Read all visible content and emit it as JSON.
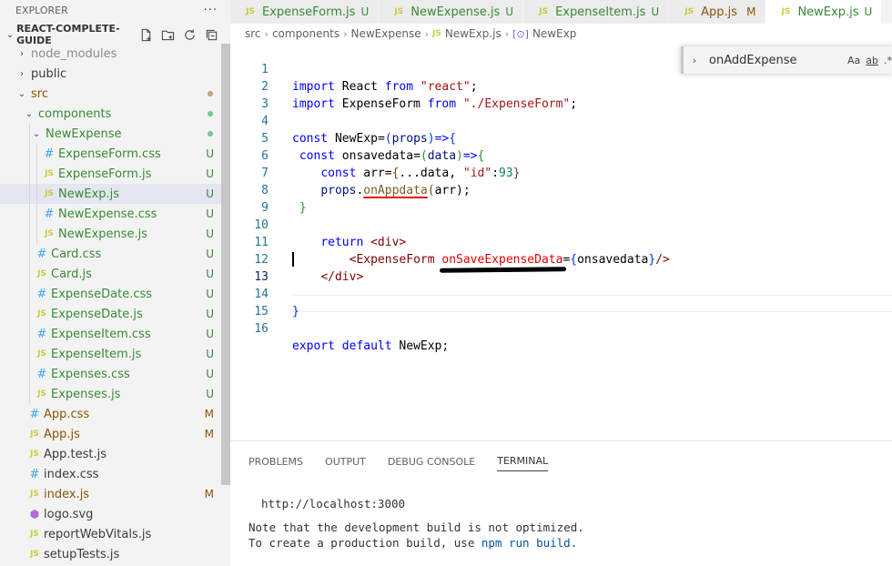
{
  "sidebar": {
    "header": "EXPLORER",
    "more": "···",
    "project": "REACT-COMPLETE-GUIDE",
    "tree": [
      {
        "name": "node_modules",
        "type": "folder",
        "depth": 0,
        "open": false,
        "style": "dim"
      },
      {
        "name": "public",
        "type": "folder",
        "depth": 0,
        "open": false,
        "style": "plain"
      },
      {
        "name": "src",
        "type": "folder",
        "depth": 0,
        "open": true,
        "style": "modified",
        "dot": "tan"
      },
      {
        "name": "components",
        "type": "folder",
        "depth": 1,
        "open": true,
        "style": "untracked",
        "dot": "green"
      },
      {
        "name": "NewExpense",
        "type": "folder",
        "depth": 2,
        "open": true,
        "style": "untracked",
        "dot": "green"
      },
      {
        "name": "ExpenseForm.css",
        "type": "css",
        "depth": 3,
        "style": "untracked",
        "badge": "U"
      },
      {
        "name": "ExpenseForm.js",
        "type": "js",
        "depth": 3,
        "style": "untracked",
        "badge": "U"
      },
      {
        "name": "NewExp.js",
        "type": "js",
        "depth": 3,
        "style": "untracked",
        "badge": "U",
        "selected": true
      },
      {
        "name": "NewExpense.css",
        "type": "css",
        "depth": 3,
        "style": "untracked",
        "badge": "U"
      },
      {
        "name": "NewExpense.js",
        "type": "js",
        "depth": 3,
        "style": "untracked",
        "badge": "U"
      },
      {
        "name": "Card.css",
        "type": "css",
        "depth": 2,
        "style": "untracked",
        "badge": "U"
      },
      {
        "name": "Card.js",
        "type": "js",
        "depth": 2,
        "style": "untracked",
        "badge": "U"
      },
      {
        "name": "ExpenseDate.css",
        "type": "css",
        "depth": 2,
        "style": "untracked",
        "badge": "U"
      },
      {
        "name": "ExpenseDate.js",
        "type": "js",
        "depth": 2,
        "style": "untracked",
        "badge": "U"
      },
      {
        "name": "ExpenseItem.css",
        "type": "css",
        "depth": 2,
        "style": "untracked",
        "badge": "U"
      },
      {
        "name": "ExpenseItem.js",
        "type": "js",
        "depth": 2,
        "style": "untracked",
        "badge": "U"
      },
      {
        "name": "Expenses.css",
        "type": "css",
        "depth": 2,
        "style": "untracked",
        "badge": "U"
      },
      {
        "name": "Expenses.js",
        "type": "js",
        "depth": 2,
        "style": "untracked",
        "badge": "U"
      },
      {
        "name": "App.css",
        "type": "css",
        "depth": 1,
        "style": "modified",
        "badge": "M"
      },
      {
        "name": "App.js",
        "type": "js",
        "depth": 1,
        "style": "modified",
        "badge": "M"
      },
      {
        "name": "App.test.js",
        "type": "js",
        "depth": 1,
        "style": "plain"
      },
      {
        "name": "index.css",
        "type": "css",
        "depth": 1,
        "style": "plain"
      },
      {
        "name": "index.js",
        "type": "js",
        "depth": 1,
        "style": "modified",
        "badge": "M"
      },
      {
        "name": "logo.svg",
        "type": "svg",
        "depth": 1,
        "style": "plain"
      },
      {
        "name": "reportWebVitals.js",
        "type": "js",
        "depth": 1,
        "style": "plain"
      },
      {
        "name": "setupTests.js",
        "type": "js",
        "depth": 1,
        "style": "plain"
      }
    ]
  },
  "tabs": [
    {
      "name": "ExpenseForm.js",
      "status": "U"
    },
    {
      "name": "NewExpense.js",
      "status": "U"
    },
    {
      "name": "ExpenseItem.js",
      "status": "U"
    },
    {
      "name": "App.js",
      "status": "M"
    },
    {
      "name": "NewExp.js",
      "status": "U",
      "active": true
    }
  ],
  "js_icon": "JS",
  "css_icon": "#",
  "breadcrumb": {
    "parts": [
      "src",
      "components",
      "NewExpense",
      "NewExp.js",
      "NewExp"
    ],
    "symbol_icon": "[⊙]"
  },
  "find": {
    "value": "onAddExpense",
    "opt_case": "Aa",
    "opt_word": "ab",
    "opt_regex": ".*"
  },
  "editor": {
    "current_line": 13,
    "lines": [
      {
        "n": "1"
      },
      {
        "n": "2"
      },
      {
        "n": "3"
      },
      {
        "n": "4"
      },
      {
        "n": "5"
      },
      {
        "n": "6"
      },
      {
        "n": "7"
      },
      {
        "n": "8"
      },
      {
        "n": "9"
      },
      {
        "n": "10"
      },
      {
        "n": "11"
      },
      {
        "n": "12"
      },
      {
        "n": "13"
      },
      {
        "n": "14"
      },
      {
        "n": "15"
      },
      {
        "n": "16"
      }
    ],
    "tokens": {
      "l1": [
        "import",
        " React ",
        "from",
        " ",
        "\"react\"",
        ";"
      ],
      "l2": [
        "import",
        " ExpenseForm ",
        "from",
        " ",
        "\"./ExpenseForm\"",
        ";"
      ],
      "l4": [
        "const",
        " NewExp",
        "=",
        "(",
        "props",
        ")",
        "=>",
        "{"
      ],
      "l5": [
        " ",
        "const",
        " onsavedata",
        "=",
        "(",
        "data",
        ")",
        "=>",
        "{"
      ],
      "l6": [
        "    ",
        "const",
        " arr",
        "=",
        "{",
        "...data, ",
        "\"id\"",
        ":",
        "93",
        "}"
      ],
      "l7": [
        "    ",
        "props",
        ".",
        "onAppdata",
        "(",
        "arr",
        ");"
      ],
      "l8": [
        " ",
        "}"
      ],
      "l10": [
        "    ",
        "return",
        " ",
        "<div>"
      ],
      "l11": [
        "        ",
        "<ExpenseForm",
        " ",
        "onSaveExpenseData",
        "=",
        "{",
        "onsavedata",
        "}",
        "/>"
      ],
      "l12": [
        "    ",
        "</div>"
      ],
      "l14": [
        "}"
      ],
      "l16": [
        "export",
        " ",
        "default",
        " NewExp;"
      ]
    }
  },
  "panel": {
    "tabs": [
      "PROBLEMS",
      "OUTPUT",
      "DEBUG CONSOLE",
      "TERMINAL"
    ],
    "active_tab": "TERMINAL",
    "terminal": {
      "url": "http://localhost:3000",
      "note1": "Note that the development build is not optimized.",
      "note2_pre": "To create a production build, use ",
      "note2_cmd": "npm run build",
      "note2_post": "."
    }
  }
}
